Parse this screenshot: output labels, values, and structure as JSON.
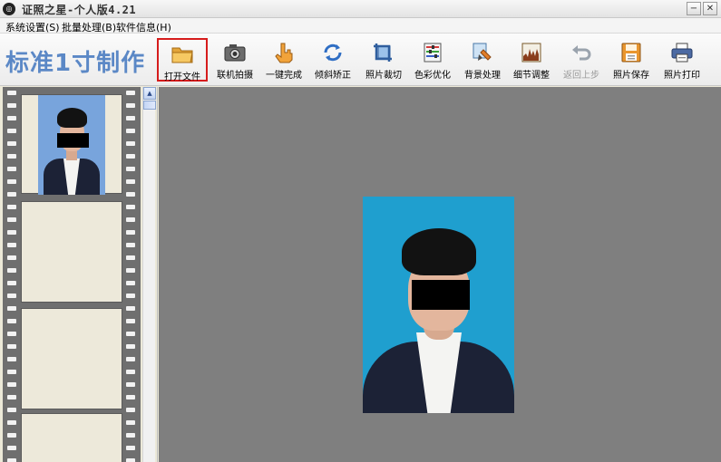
{
  "window": {
    "title": "证照之星-个人版4.21",
    "app_icon": "app-logo-icon",
    "minimize_icon": "minimize-icon",
    "close_icon": "close-icon"
  },
  "menu": {
    "items": [
      {
        "label": "系统设置(S)"
      },
      {
        "label": "批量处理(B)"
      },
      {
        "label": "软件信息(H)"
      }
    ]
  },
  "toolbar": {
    "brand_title": "标准1寸制作",
    "tools": [
      {
        "label": "打开文件",
        "icon": "folder-open-icon",
        "highlighted": true
      },
      {
        "label": "联机拍摄",
        "icon": "camera-icon"
      },
      {
        "label": "一键完成",
        "icon": "hand-click-icon"
      },
      {
        "label": "倾斜矫正",
        "icon": "rotate-correct-icon"
      },
      {
        "label": "照片裁切",
        "icon": "crop-icon"
      },
      {
        "label": "色彩优化",
        "icon": "color-adjust-icon"
      },
      {
        "label": "背景处理",
        "icon": "background-brush-icon"
      },
      {
        "label": "细节调整",
        "icon": "detail-chart-icon"
      },
      {
        "label": "返回上步",
        "icon": "undo-icon",
        "disabled": true
      },
      {
        "label": "照片保存",
        "icon": "save-icon"
      },
      {
        "label": "照片打印",
        "icon": "printer-icon"
      }
    ]
  },
  "colors": {
    "brand": "#5b88c6",
    "photo_background": "#1f9fcf",
    "thumb_background": "#78a4dc",
    "canvas": "#7f7f7f",
    "highlight_border": "#d61c1c"
  }
}
